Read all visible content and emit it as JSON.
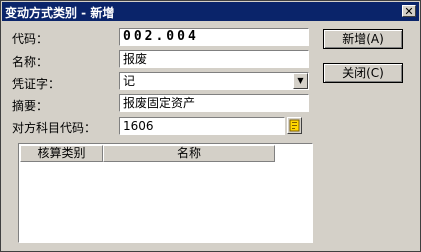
{
  "window": {
    "title": "变动方式类别 - 新增",
    "close_glyph": "✕"
  },
  "form": {
    "code_label": "代码：",
    "code_value": "002.004",
    "name_label": "名称：",
    "name_value": "报废",
    "voucher_label": "凭证字：",
    "voucher_value": "记",
    "summary_label": "摘要：",
    "summary_value": "报废固定资产",
    "account_label": "对方科目代码：",
    "account_value": "1606"
  },
  "buttons": {
    "new_label": "新增(A)",
    "close_label": "关闭(C)"
  },
  "grid": {
    "columns": [
      "核算类别",
      "名称"
    ]
  },
  "icons": {
    "dropdown": "triangle-down",
    "lookup": "yellow-lookup"
  }
}
